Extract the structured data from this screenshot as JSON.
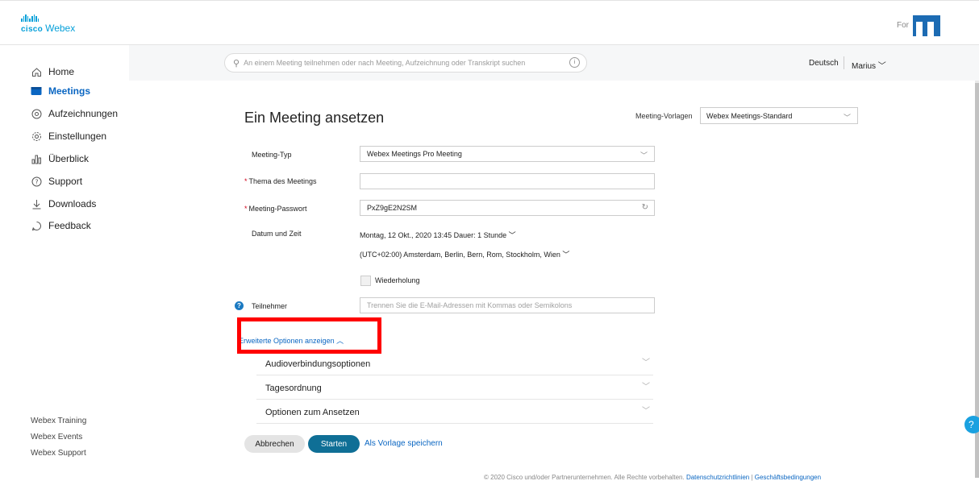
{
  "brand": {
    "cisco": "cisco",
    "webex": "Webex",
    "for_label": "For"
  },
  "header": {
    "search_placeholder": "An einem Meeting teilnehmen oder nach Meeting, Aufzeichnung oder Transkript suchen",
    "language": "Deutsch",
    "user": "Marius"
  },
  "sidebar": {
    "items": [
      {
        "label": "Home",
        "icon": "home-icon"
      },
      {
        "label": "Meetings",
        "icon": "meetings-icon"
      },
      {
        "label": "Aufzeichnungen",
        "icon": "recordings-icon"
      },
      {
        "label": "Einstellungen",
        "icon": "gear-icon"
      },
      {
        "label": "Überblick",
        "icon": "chart-icon"
      },
      {
        "label": "Support",
        "icon": "question-icon"
      },
      {
        "label": "Downloads",
        "icon": "download-icon"
      },
      {
        "label": "Feedback",
        "icon": "feedback-icon"
      }
    ],
    "footer": [
      "Webex Training",
      "Webex Events",
      "Webex Support"
    ]
  },
  "form": {
    "title": "Ein Meeting ansetzen",
    "vorlagen_label": "Meeting-Vorlagen",
    "vorlagen_value": "Webex Meetings-Standard",
    "typ_label": "Meeting-Typ",
    "typ_value": "Webex Meetings Pro Meeting",
    "thema_label": "Thema des Meetings",
    "thema_value": "",
    "passwort_label": "Meeting-Passwort",
    "passwort_value": "PxZ9gE2N2SM",
    "datum_label": "Datum und Zeit",
    "datum_value": "Montag, 12 Okt., 2020 13:45",
    "dauer_label": "Dauer:",
    "dauer_value": "1 Stunde",
    "zeitzone": "(UTC+02:00) Amsterdam, Berlin, Bern, Rom, Stockholm, Wien",
    "wiederholung": "Wiederholung",
    "teilnehmer_label": "Teilnehmer",
    "teilnehmer_placeholder": "Trennen Sie die E-Mail-Adressen mit Kommas oder Semikolons",
    "erweitert_link": "Erweiterte Optionen anzeigen",
    "sections": [
      "Audioverbindungsoptionen",
      "Tagesordnung",
      "Optionen zum Ansetzen"
    ],
    "cancel": "Abbrechen",
    "start": "Starten",
    "save_template": "Als Vorlage speichern"
  },
  "footer": {
    "copyright": "© 2020 Cisco und/oder Partnerunternehmen. Alle Rechte vorbehalten.",
    "privacy": "Datenschutzrichtlinien",
    "terms": "Geschäftsbedingungen"
  }
}
